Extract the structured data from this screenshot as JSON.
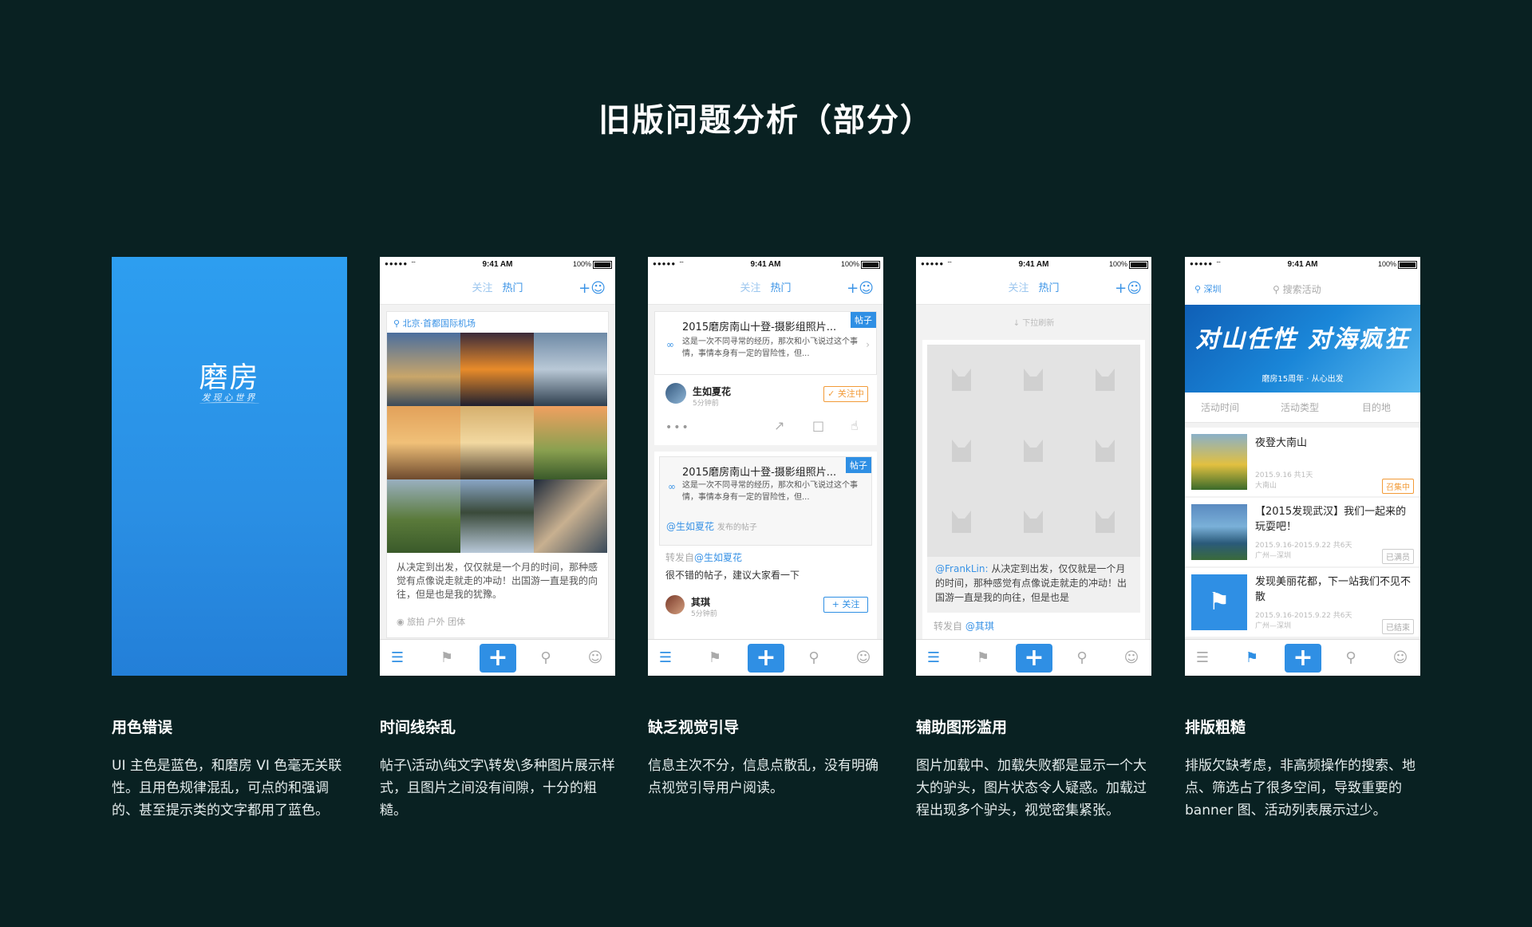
{
  "title": "旧版问题分析（部分）",
  "status_bar": {
    "signal": "●●●●● ⌔",
    "time": "9:41 AM",
    "battery": "100%"
  },
  "nav": {
    "follow": "关注",
    "hot": "热门"
  },
  "columns": [
    {
      "title": "用色错误",
      "desc": "UI 主色是蓝色，和磨房 VI 色毫无关联性。且用色规律混乱，可点的和强调的、甚至提示类的文字都用了蓝色。"
    },
    {
      "title": "时间线杂乱",
      "desc": "帖子\\活动\\纯文字\\转发\\多种图片展示样式，且图片之间没有间隙，十分的粗糙。"
    },
    {
      "title": "缺乏视觉引导",
      "desc": "信息主次不分，信息点散乱，没有明确点视觉引导用户阅读。"
    },
    {
      "title": "辅助图形滥用",
      "desc": "图片加载中、加载失败都是显示一个大大的驴头，图片状态令人疑惑。加载过程出现多个驴头，视觉密集紧张。"
    },
    {
      "title": "排版粗糙",
      "desc": "排版欠缺考虑，非高频操作的搜索、地点、筛选占了很多空间，导致重要的 banner 图、活动列表展示过少。"
    }
  ],
  "splash": {
    "logo": "磨房",
    "slogan": "发现心世界"
  },
  "feed": {
    "location": "北京·首都国际机场",
    "text": "从决定到出发，仅仅就是一个月的时间，那种感觉有点像说走就走的冲动！出国游一直是我的向往，但是也是我的犹豫。",
    "tags": "旅拍  户外  团体"
  },
  "visual": {
    "post_tag": "帖子",
    "post_title": "2015磨房南山十登-摄影组照片...",
    "post_excerpt": "这是一次不同寻常的经历，那次和小飞说过这个事情，事情本身有一定的冒险性，但...",
    "user1": "生如夏花",
    "time1": "5分钟前",
    "following": "✓ 关注中",
    "mention": "@生如夏花",
    "published": "发布的帖子",
    "repost_from": "转发自",
    "repost_user": "@生如夏花",
    "repost_text": "很不错的帖子，建议大家看一下",
    "user2": "其琪",
    "time2": "5分钟前",
    "follow": "+ 关注"
  },
  "loading": {
    "pull": "↓ 下拉刷新",
    "mention": "@FrankLin:",
    "text": " 从决定到出发，仅仅就是一个月的时间，那种感觉有点像说走就走的冲动！出国游一直是我的向往，但是也是",
    "repost_from": "转发自",
    "repost_user": "@其琪"
  },
  "layout": {
    "city": "深圳",
    "search": "搜索活动",
    "banner_text": "对山任性 对海疯狂",
    "banner_sub": "磨房15周年 · 从心出发",
    "filters": [
      "活动时间",
      "活动类型",
      "目的地"
    ],
    "items": [
      {
        "title": "夜登大南山",
        "date": "2015.9.16 共1天",
        "place": "大南山",
        "badge": "召集中"
      },
      {
        "title": "【2015发现武汉】我们一起来的玩耍吧！",
        "date": "2015.9.16-2015.9.22 共6天",
        "place": "广州—深圳",
        "badge": "已满员"
      },
      {
        "title": "发现美丽花都，下一站我们不见不散",
        "date": "2015.9.16-2015.9.22 共6天",
        "place": "广州—深圳",
        "badge": "已结束"
      }
    ]
  },
  "colors": {
    "background": "#092122",
    "primary_blue": "#2f8fe4",
    "orange": "#f29b38"
  }
}
